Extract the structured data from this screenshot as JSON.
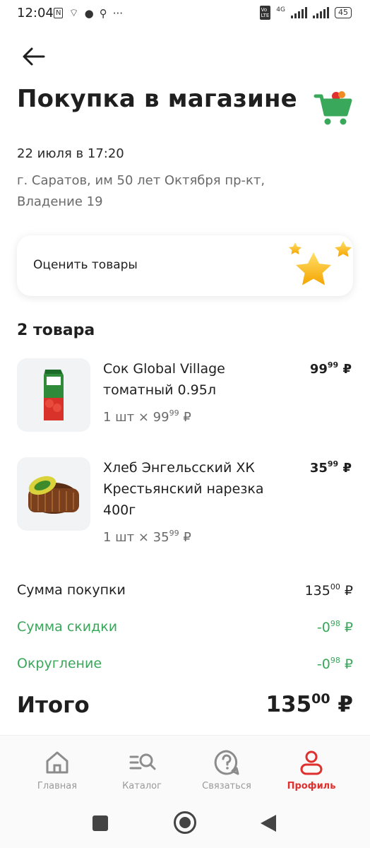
{
  "status_bar": {
    "time": "12:04",
    "network": "4G",
    "battery": "45",
    "more": "···"
  },
  "header": {
    "title": "Покупка в магазине"
  },
  "purchase": {
    "date": "22 июля в 17:20",
    "address": "г. Саратов, им 50 лет Октября пр-кт, Владение 19"
  },
  "rate_card": {
    "label": "Оценить товары"
  },
  "items_count": "2 товара",
  "items": [
    {
      "name": "Сок Global Village томатный 0.95л",
      "qty": "1 шт ×",
      "price_int": "99",
      "price_kop": "99",
      "currency": "₽",
      "image": "juice-carton"
    },
    {
      "name": "Хлеб Энгельсский ХК Крестьянский нарезка 400г",
      "qty": "1 шт ×",
      "price_int": "35",
      "price_kop": "99",
      "currency": "₽",
      "image": "bread-loaf"
    }
  ],
  "summary": {
    "subtotal_label": "Сумма покупки",
    "subtotal_int": "135",
    "subtotal_kop": "00",
    "discount_label": "Сумма скидки",
    "discount_int": "-0",
    "discount_kop": "98",
    "rounding_label": "Округление",
    "rounding_int": "-0",
    "rounding_kop": "98",
    "total_label": "Итого",
    "total_int": "135",
    "total_kop": "00",
    "currency": "₽"
  },
  "bottom_nav": [
    {
      "label": "Главная",
      "icon": "home-icon",
      "active": false
    },
    {
      "label": "Каталог",
      "icon": "catalog-search-icon",
      "active": false
    },
    {
      "label": "Связаться",
      "icon": "help-chat-icon",
      "active": false
    },
    {
      "label": "Профиль",
      "icon": "profile-icon",
      "active": true
    }
  ],
  "colors": {
    "accent_green": "#39a85a",
    "active_red": "#e0302e",
    "text": "#1f1f1f",
    "muted": "#6a6a6a"
  }
}
